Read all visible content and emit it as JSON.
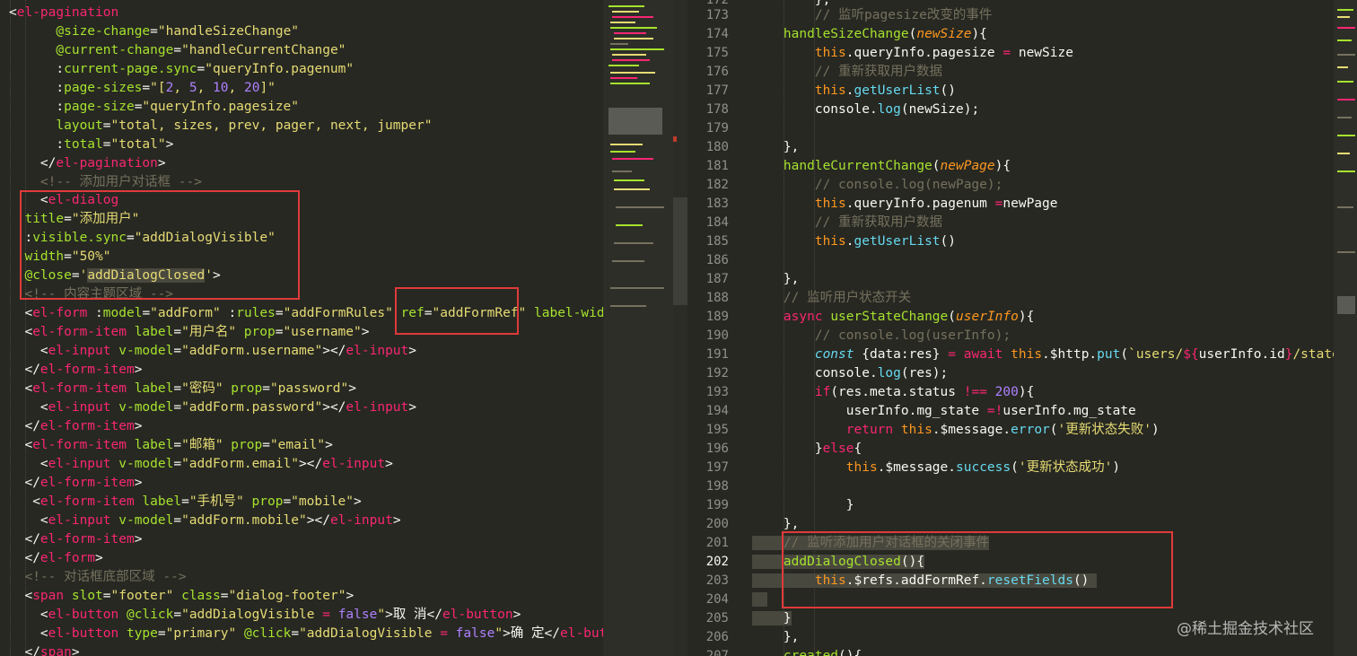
{
  "left_code": [
    "<el-pagination",
    "      @size-change=\"handleSizeChange\"",
    "      @current-change=\"handleCurrentChange\"",
    "      :current-page.sync=\"queryInfo.pagenum\"",
    "      :page-sizes=\"[2, 5, 10, 20]\"",
    "      :page-size=\"queryInfo.pagesize\"",
    "      layout=\"total, sizes, prev, pager, next, jumper\"",
    "      :total=\"total\">",
    "    </el-pagination>",
    "    <!-- 添加用户对话框 -->",
    "    <el-dialog",
    "  title=\"添加用户\"",
    "  :visible.sync=\"addDialogVisible\"",
    "  width=\"50%\"",
    "  @close='addDialogClosed'>",
    "  <!-- 内容主题区域 -->",
    "  <el-form :model=\"addForm\" :rules=\"addFormRules\" ref=\"addFormRef\" label-width",
    "  <el-form-item label=\"用户名\" prop=\"username\">",
    "    <el-input v-model=\"addForm.username\"></el-input>",
    "  </el-form-item>",
    "  <el-form-item label=\"密码\" prop=\"password\">",
    "    <el-input v-model=\"addForm.password\"></el-input>",
    "  </el-form-item>",
    "  <el-form-item label=\"邮箱\" prop=\"email\">",
    "    <el-input v-model=\"addForm.email\"></el-input>",
    "  </el-form-item>",
    "   <el-form-item label=\"手机号\" prop=\"mobile\">",
    "    <el-input v-model=\"addForm.mobile\"></el-input>",
    "  </el-form-item>",
    "  </el-form>",
    "  <!-- 对话框底部区域 -->",
    "  <span slot=\"footer\" class=\"dialog-footer\">",
    "    <el-button @click=\"addDialogVisible = false\">取 消</el-button>",
    "    <el-button type=\"primary\" @click=\"addDialogVisible = false\">确 定</el-butt",
    "  </span>"
  ],
  "right_line_numbers": [
    "172",
    "173",
    "174",
    "175",
    "176",
    "177",
    "178",
    "179",
    "180",
    "181",
    "182",
    "183",
    "184",
    "185",
    "186",
    "187",
    "188",
    "189",
    "190",
    "191",
    "192",
    "193",
    "194",
    "195",
    "196",
    "197",
    "198",
    "199",
    "200",
    "201",
    "202",
    "203",
    "204",
    "205",
    "206",
    "207"
  ],
  "current_line": "202",
  "right_code": [
    "        },",
    "        // 监听pagesize改变的事件",
    "    handleSizeChange(newSize){",
    "        this.queryInfo.pagesize = newSize",
    "        // 重新获取用户数据",
    "        this.getUserList()",
    "        console.log(newSize);",
    "",
    "    },",
    "    handleCurrentChange(newPage){",
    "        // console.log(newPage);",
    "        this.queryInfo.pagenum =newPage",
    "        // 重新获取用户数据",
    "        this.getUserList()",
    "",
    "    },",
    "    // 监听用户状态开关",
    "    async userStateChange(userInfo){",
    "        // console.log(userInfo);",
    "        const {data:res} = await this.$http.put(`users/${userInfo.id}/state/",
    "        console.log(res);",
    "        if(res.meta.status !== 200){",
    "            userInfo.mg_state =!userInfo.mg_state",
    "            return this.$message.error('更新状态失败')",
    "        }else{",
    "            this.$message.success('更新状态成功')",
    "",
    "            }",
    "    },",
    "    // 监听添加用户对话框的关闭事件",
    "    addDialogClosed(){",
    "        this.$refs.addFormRef.resetFields()",
    "",
    "    }",
    "    },",
    "    created(){"
  ],
  "watermark": "@稀土掘金技术社区",
  "colors": {
    "background": "#272822",
    "tag": "#f92672",
    "attribute": "#a6e22e",
    "string": "#e6db74",
    "comment": "#75715e",
    "highlight_box": "#e03a3a"
  }
}
